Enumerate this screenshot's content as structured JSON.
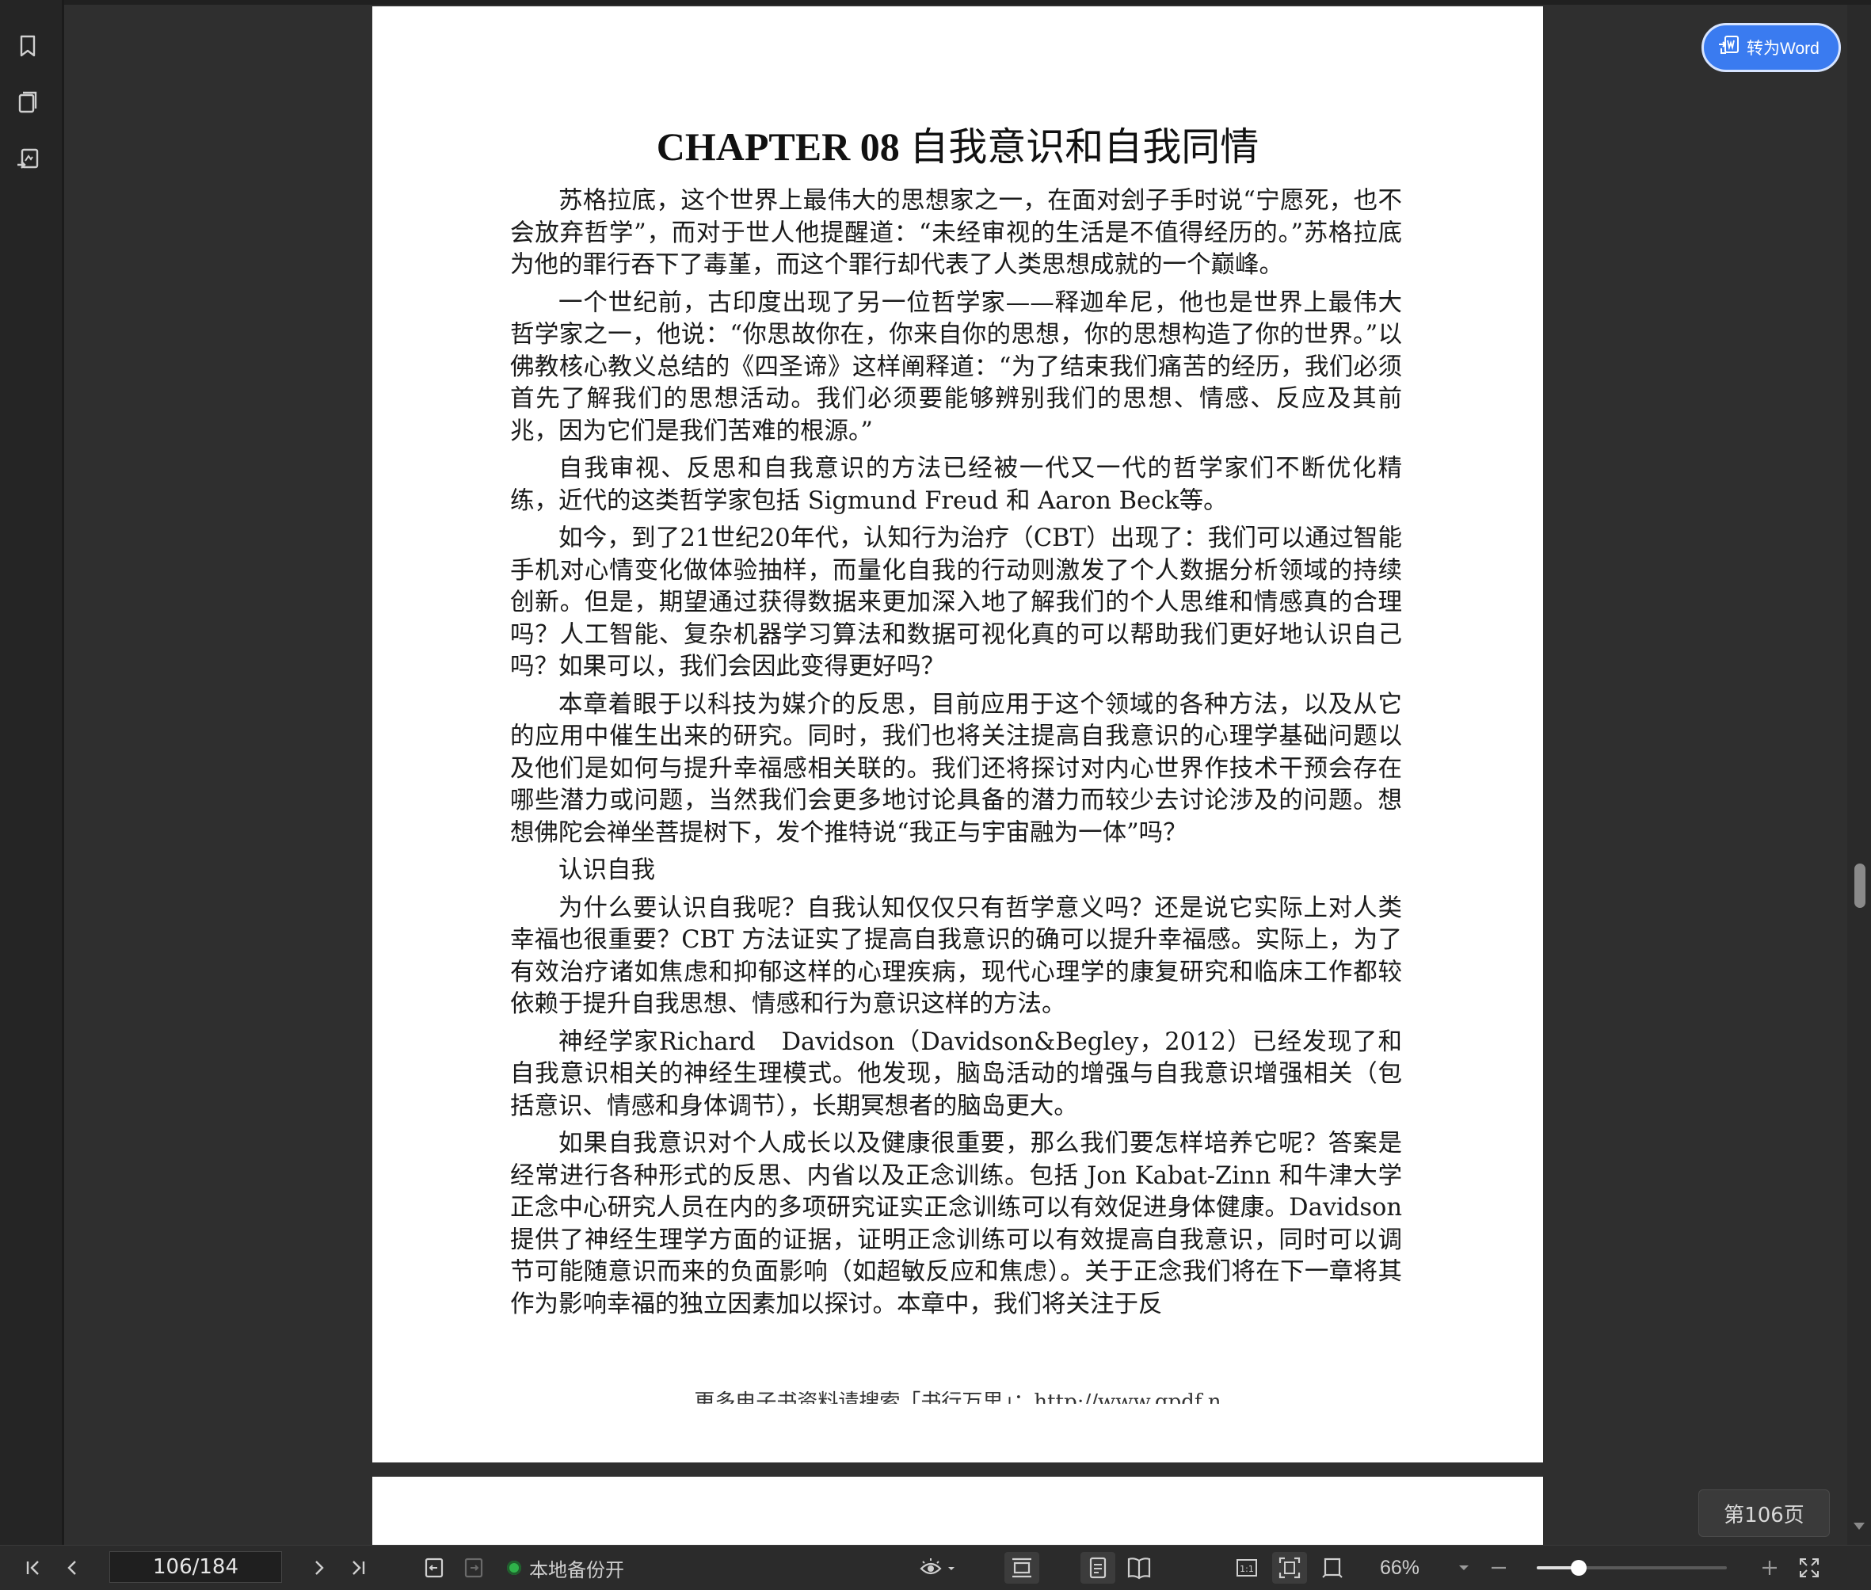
{
  "toolbar_right": {
    "convert_word_label": "转为Word",
    "page_badge": "第106页"
  },
  "document": {
    "title_en": "CHAPTER 08",
    "title_cn": "自我意识和自我同情",
    "paragraphs": [
      "苏格拉底，这个世界上最伟大的思想家之一，在面对刽子手时说“宁愿死，也不会放弃哲学”，而对于世人他提醒道：“未经审视的生活是不值得经历的。”苏格拉底为他的罪行吞下了毒堇，而这个罪行却代表了人类思想成就的一个巅峰。",
      "一个世纪前，古印度出现了另一位哲学家——释迦牟尼，他也是世界上最伟大哲学家之一，他说：“你思故你在，你来自你的思想，你的思想构造了你的世界。”以佛教核心教义总结的《四圣谛》这样阐释道：“为了结束我们痛苦的经历，我们必须首先了解我们的思想活动。我们必须要能够辨别我们的思想、情感、反应及其前兆，因为它们是我们苦难的根源。”",
      "自我审视、反思和自我意识的方法已经被一代又一代的哲学家们不断优化精练，近代的这类哲学家包括 Sigmund Freud 和 Aaron Beck等。",
      "如今，到了21世纪20年代，认知行为治疗（CBT）出现了：我们可以通过智能手机对心情变化做体验抽样，而量化自我的行动则激发了个人数据分析领域的持续创新。但是，期望通过获得数据来更加深入地了解我们的个人思维和情感真的合理吗？人工智能、复杂机器学习算法和数据可视化真的可以帮助我们更好地认识自己吗？如果可以，我们会因此变得更好吗？",
      "本章着眼于以科技为媒介的反思，目前应用于这个领域的各种方法，以及从它的应用中催生出来的研究。同时，我们也将关注提高自我意识的心理学基础问题以及他们是如何与提升幸福感相关联的。我们还将探讨对内心世界作技术干预会存在哪些潜力或问题，当然我们会更多地讨论具备的潜力而较少去讨论涉及的问题。想想佛陀会禅坐菩提树下，发个推特说“我正与宇宙融为一体”吗？",
      "认识自我",
      "为什么要认识自我呢？自我认知仅仅只有哲学意义吗？还是说它实际上对人类幸福也很重要？CBT 方法证实了提高自我意识的确可以提升幸福感。实际上，为了有效治疗诸如焦虑和抑郁这样的心理疾病，现代心理学的康复研究和临床工作都较依赖于提升自我思想、情感和行为意识这样的方法。",
      "神经学家Richard　Davidson（Davidson&Begley，2012）已经发现了和自我意识相关的神经生理模式。他发现，脑岛活动的增强与自我意识增强相关（包括意识、情感和身体调节），长期冥想者的脑岛更大。",
      "如果自我意识对个人成长以及健康很重要，那么我们要怎样培养它呢？答案是经常进行各种形式的反思、内省以及正念训练。包括 Jon Kabat-Zinn 和牛津大学正念中心研究人员在内的多项研究证实正念训练可以有效促进身体健康。Davidson 提供了神经生理学方面的证据，证明正念训练可以有效提高自我意识，同时可以调节可能随意识而来的负面影响（如超敏反应和焦虑）。关于正念我们将在下一章将其作为影响幸福的独立因素加以探讨。本章中，我们将关注于反"
    ],
    "footer_note": "更多电子书资料请搜索「书行万里」：http://www.gpdf.n"
  },
  "bottom_bar": {
    "page_value": "106/184",
    "backup_label": "本地备份开",
    "zoom_label": "66%",
    "zoom_fraction": 0.22
  }
}
